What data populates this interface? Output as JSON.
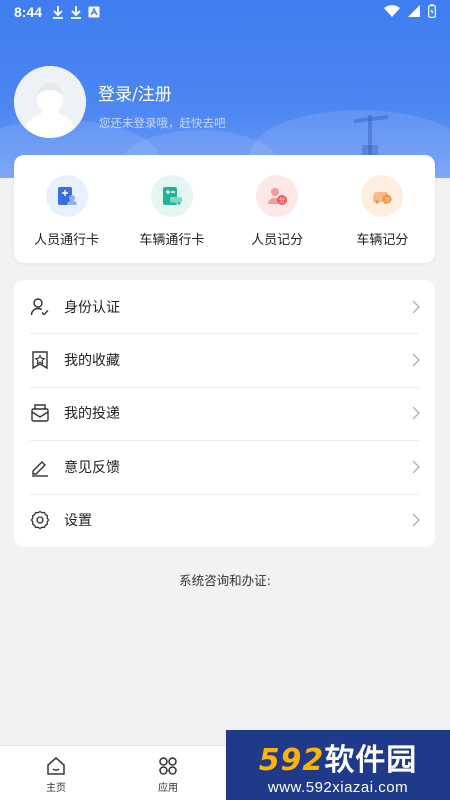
{
  "status_bar": {
    "time": "8:44"
  },
  "profile": {
    "login_title": "登录/注册",
    "login_subtitle": "您还未登录哦，赶快去吧"
  },
  "quick_actions": [
    {
      "label": "人员通行卡",
      "icon": "person-pass-icon",
      "color": "#3a6fe0",
      "bg": "#e9f0fd"
    },
    {
      "label": "车辆通行卡",
      "icon": "vehicle-pass-icon",
      "color": "#1fb39a",
      "bg": "#e3f6f1"
    },
    {
      "label": "人员记分",
      "icon": "person-score-icon",
      "color": "#ef5b5b",
      "bg": "#fde8e8"
    },
    {
      "label": "车辆记分",
      "icon": "vehicle-score-icon",
      "color": "#f0913a",
      "bg": "#fdeee0"
    }
  ],
  "menu": [
    {
      "label": "身份认证",
      "icon": "identity-icon"
    },
    {
      "label": "我的收藏",
      "icon": "favorites-icon"
    },
    {
      "label": "我的投递",
      "icon": "delivery-icon"
    },
    {
      "label": "意见反馈",
      "icon": "feedback-icon"
    },
    {
      "label": "设置",
      "icon": "settings-icon"
    }
  ],
  "consult_text": "系统咨询和办证:",
  "bottom_nav": [
    {
      "label": "主页",
      "icon": "home-icon"
    },
    {
      "label": "应用",
      "icon": "apps-icon"
    }
  ],
  "watermark": {
    "title_num": "592",
    "title_text": "软件园",
    "url": "www.592xiazai.com"
  }
}
